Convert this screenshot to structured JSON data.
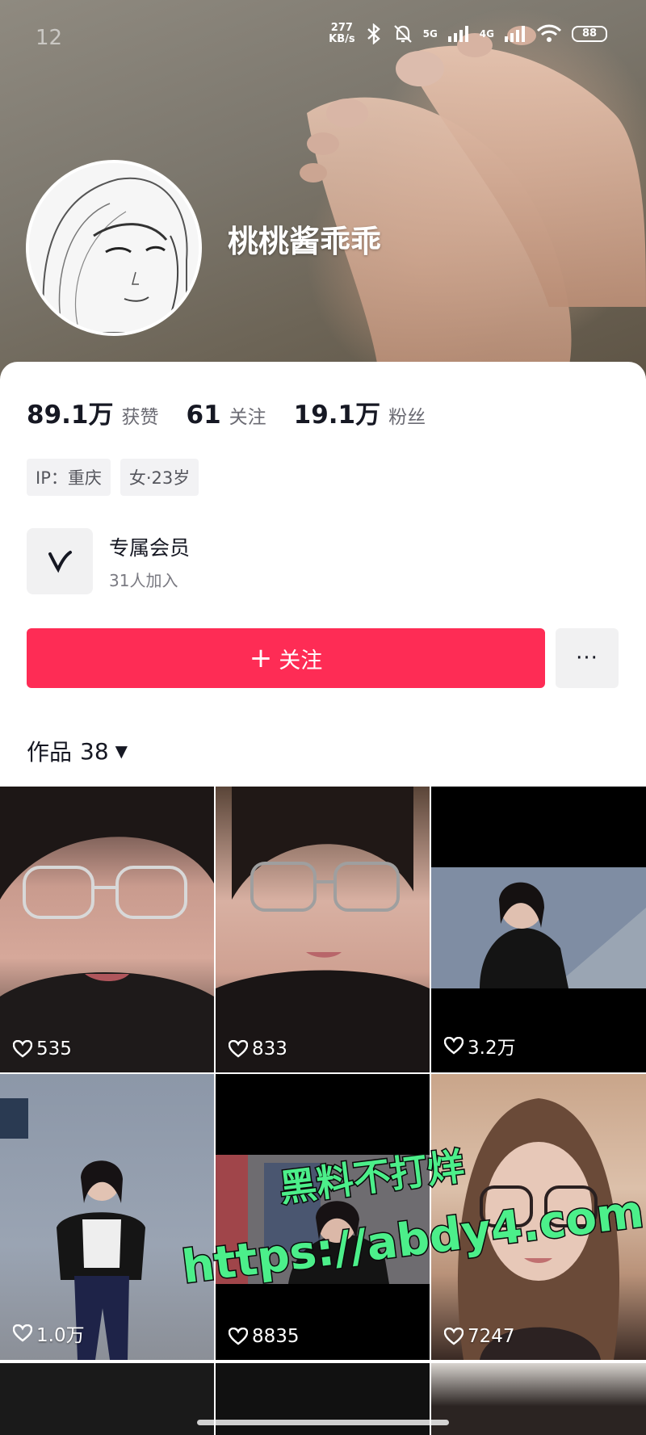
{
  "status_bar": {
    "time": "12",
    "speed_value": "277",
    "speed_unit": "KB/s",
    "net1": "5G",
    "net2": "4G",
    "battery": "88"
  },
  "profile": {
    "nickname": "桃桃酱乖乖",
    "stats": [
      {
        "value": "89.1万",
        "label": "获赞"
      },
      {
        "value": "61",
        "label": "关注"
      },
      {
        "value": "19.1万",
        "label": "粉丝"
      }
    ],
    "tags": [
      "IP：重庆",
      "女·23岁"
    ],
    "membership": {
      "title": "专属会员",
      "subtitle": "31人加入"
    },
    "follow_label": "关注",
    "more_label": "···"
  },
  "works": {
    "label": "作品",
    "count": "38",
    "tiles": [
      {
        "likes": "535"
      },
      {
        "likes": "833"
      },
      {
        "likes": "3.2万"
      },
      {
        "likes": "1.0万"
      },
      {
        "likes": "8835"
      },
      {
        "likes": "7247"
      }
    ]
  },
  "watermark": {
    "line1": "黑料不打烊",
    "line2": "https://abdy4.com"
  },
  "colors": {
    "accent": "#fe2c55",
    "watermark": "#4cef8a"
  }
}
